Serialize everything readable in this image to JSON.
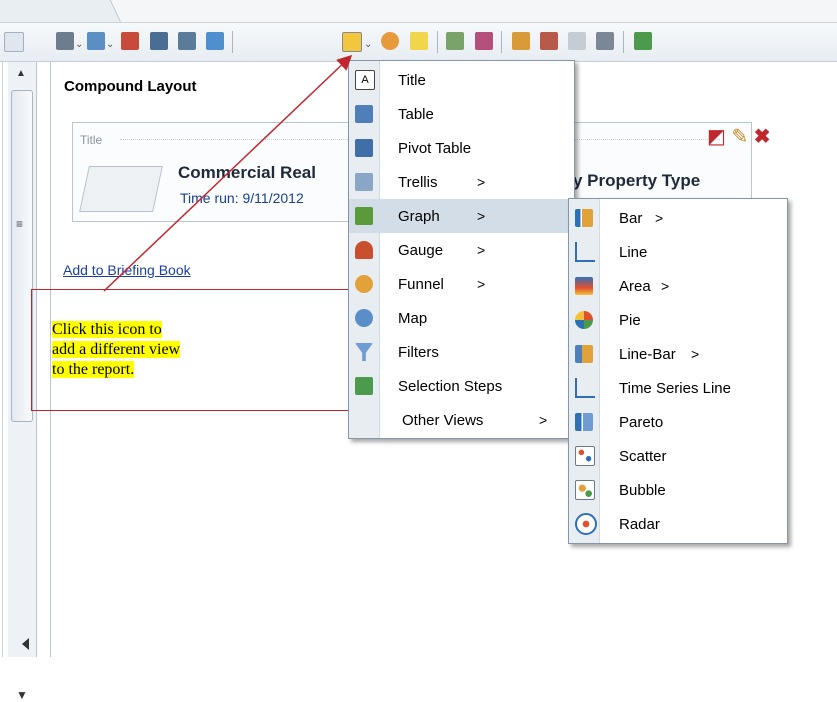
{
  "panel": {
    "title": "Compound Layout"
  },
  "view": {
    "title_label": "Title",
    "report_title_left": "Commercial Real",
    "report_title_right": "y Property Type",
    "time_run": "Time run: 9/11/2012",
    "add_link": "Add to Briefing Book"
  },
  "callout": {
    "lines": [
      "Click this icon to",
      "add a different view",
      "to the report."
    ]
  },
  "main_menu": [
    {
      "label": "Title",
      "icon": "title-icon",
      "submenu": false
    },
    {
      "label": "Table",
      "icon": "table-icon",
      "submenu": false
    },
    {
      "label": "Pivot Table",
      "icon": "pivot-table-icon",
      "submenu": false
    },
    {
      "label": "Trellis",
      "icon": "trellis-icon",
      "submenu": true
    },
    {
      "label": "Graph",
      "icon": "graph-icon",
      "submenu": true,
      "highlighted": true
    },
    {
      "label": "Gauge",
      "icon": "gauge-icon",
      "submenu": true
    },
    {
      "label": "Funnel",
      "icon": "funnel-icon",
      "submenu": true
    },
    {
      "label": "Map",
      "icon": "map-icon",
      "submenu": false
    },
    {
      "label": "Filters",
      "icon": "filter-icon",
      "submenu": false
    },
    {
      "label": "Selection Steps",
      "icon": "selection-steps-icon",
      "submenu": false
    },
    {
      "label": "Other Views",
      "icon": "",
      "submenu": true
    }
  ],
  "graph_menu": [
    {
      "label": "Bar",
      "icon": "bar-chart-icon",
      "submenu": true
    },
    {
      "label": "Line",
      "icon": "line-chart-icon",
      "submenu": false
    },
    {
      "label": "Area",
      "icon": "area-chart-icon",
      "submenu": true
    },
    {
      "label": "Pie",
      "icon": "pie-chart-icon",
      "submenu": false
    },
    {
      "label": "Line-Bar",
      "icon": "line-bar-chart-icon",
      "submenu": true
    },
    {
      "label": "Time Series Line",
      "icon": "time-series-icon",
      "submenu": false
    },
    {
      "label": "Pareto",
      "icon": "pareto-icon",
      "submenu": false
    },
    {
      "label": "Scatter",
      "icon": "scatter-icon",
      "submenu": false
    },
    {
      "label": "Bubble",
      "icon": "bubble-icon",
      "submenu": false
    },
    {
      "label": "Radar",
      "icon": "radar-icon",
      "submenu": false
    }
  ],
  "glyphs": {
    "submenu_arrow": ">",
    "scroll_up": "▲",
    "scroll_down": "▼",
    "grip": "≡"
  },
  "colors": {
    "accent_red": "#c0272d",
    "highlight": "#ffff00",
    "menu_hover": "#d3dde8"
  }
}
